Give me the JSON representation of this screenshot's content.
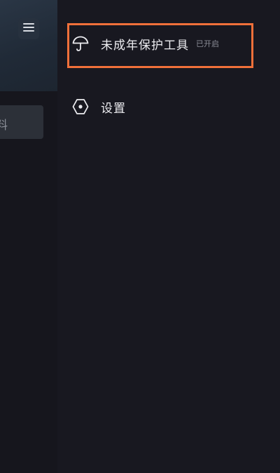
{
  "background_page": {
    "menu_icon": "hamburger-menu-icon",
    "card_text_fragment": "料"
  },
  "drawer": {
    "items": [
      {
        "icon": "umbrella-icon",
        "label": "未成年保护工具",
        "status": "已开启"
      },
      {
        "icon": "hexagon-settings-icon",
        "label": "设置"
      }
    ]
  },
  "highlight": {
    "color": "#f0703a",
    "target": "未成年保护工具"
  },
  "colors": {
    "drawer_background": "#181820",
    "text_primary": "#ececf0",
    "text_secondary": "#8a8c96",
    "accent_highlight": "#f0703a"
  }
}
